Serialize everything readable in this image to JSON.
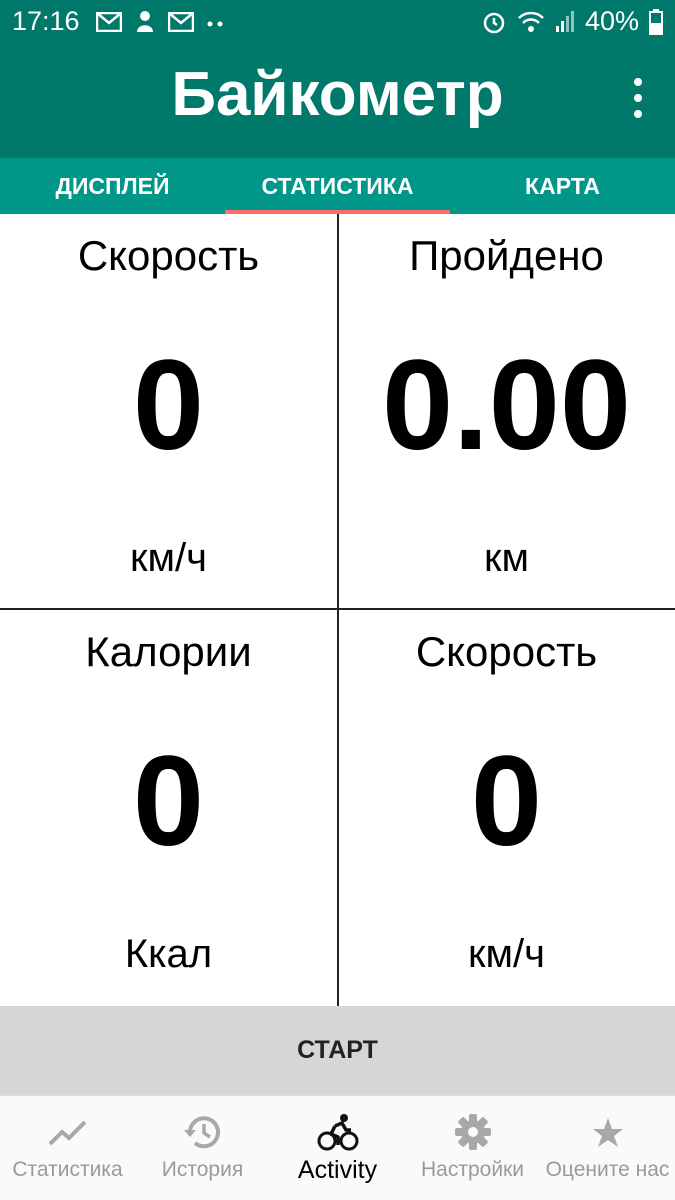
{
  "status_bar": {
    "time": "17:16",
    "battery_percent": "40%",
    "icons": [
      "mail-icon",
      "notification-icon",
      "mail-icon",
      "more-notifications-icon",
      "alarm-icon",
      "wifi-icon",
      "signal-icon",
      "battery-icon"
    ]
  },
  "app_bar": {
    "title": "Байкометр",
    "menu_icon": "overflow-menu-icon"
  },
  "tabs": [
    {
      "label": "ДИСПЛЕЙ",
      "active": false
    },
    {
      "label": "СТАТИСТИКА",
      "active": true
    },
    {
      "label": "КАРТА",
      "active": false
    }
  ],
  "stats": [
    {
      "label": "Скорость",
      "value": "0",
      "unit": "км/ч"
    },
    {
      "label": "Пройдено",
      "value": "0.00",
      "unit": "км"
    },
    {
      "label": "Калории",
      "value": "0",
      "unit": "Ккал"
    },
    {
      "label": "Скорость",
      "value": "0",
      "unit": "км/ч"
    }
  ],
  "start_button": {
    "label": "СТАРТ"
  },
  "bottom_nav": [
    {
      "label": "Статистика",
      "icon": "trending-up-icon",
      "active": false
    },
    {
      "label": "История",
      "icon": "history-icon",
      "active": false
    },
    {
      "label": "Activity",
      "icon": "bike-icon",
      "active": true
    },
    {
      "label": "Настройки",
      "icon": "gear-icon",
      "active": false
    },
    {
      "label": "Оцените нас",
      "icon": "star-icon",
      "active": false
    }
  ],
  "colors": {
    "primary_dark": "#00796b",
    "tab_bar": "#009688",
    "tab_indicator": "#ff6e6e",
    "start_button_bg": "#d6d6d6"
  }
}
